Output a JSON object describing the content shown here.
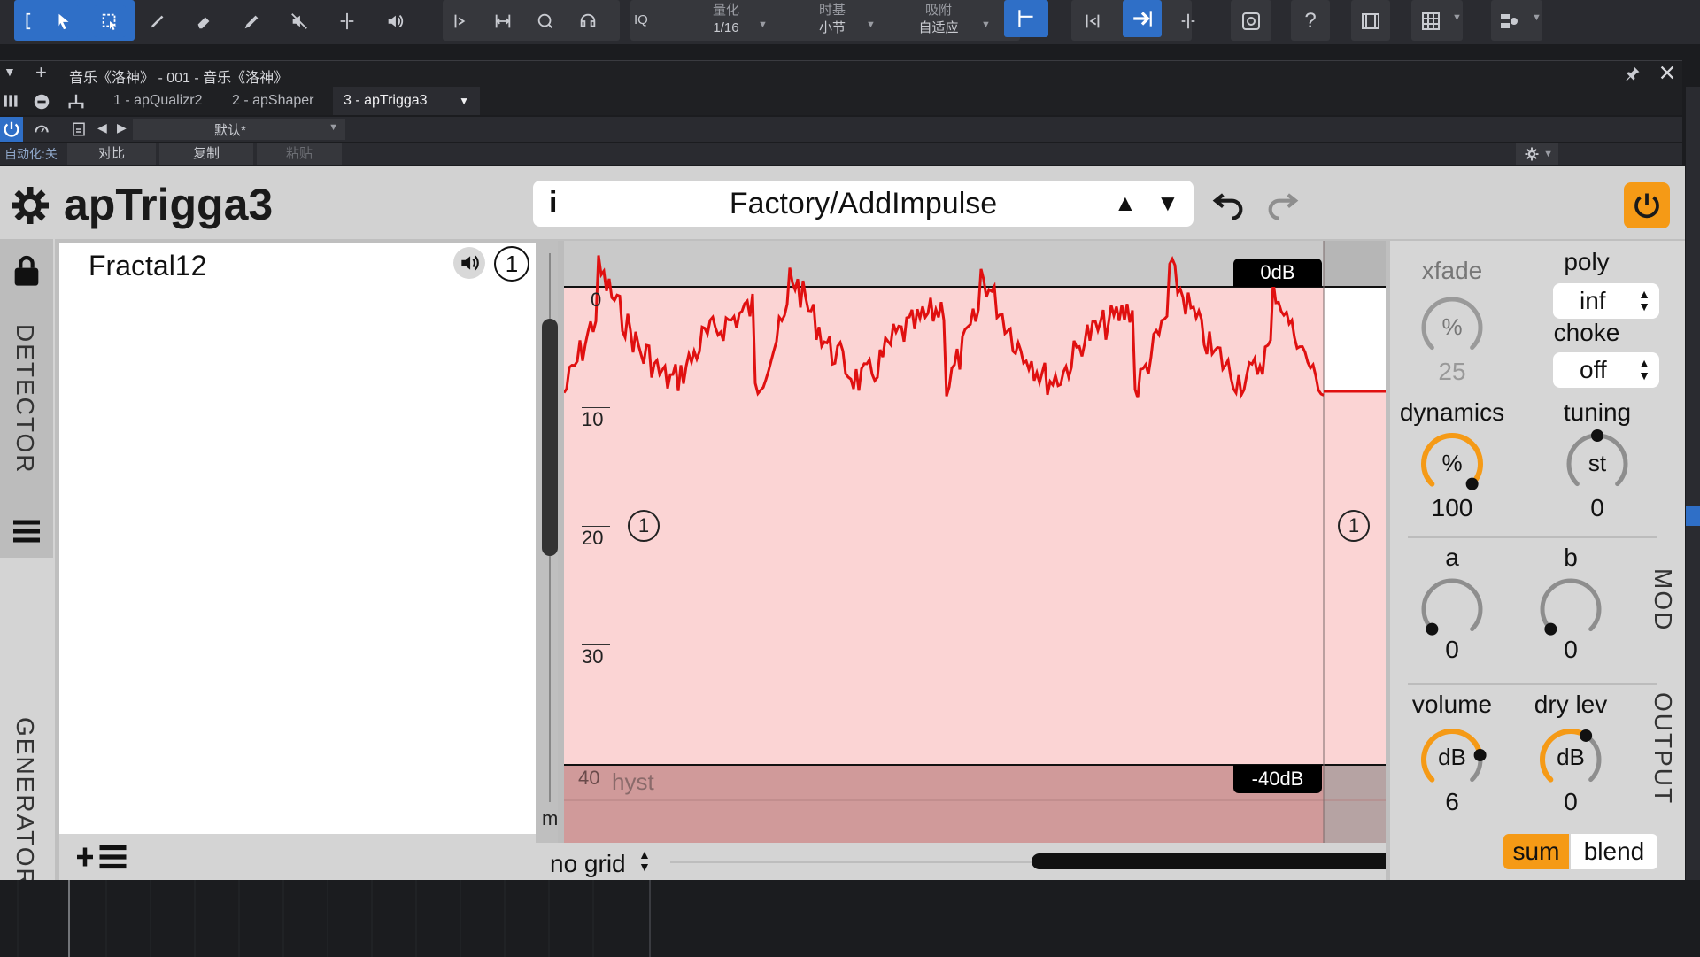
{
  "toolbar": {
    "quantize_label": "量化",
    "quantize_value": "1/16",
    "timebase_label": "时基",
    "timebase_value": "小节",
    "snap_label": "吸附",
    "snap_value": "自适应",
    "iq_label": "IQ",
    "help_label": "?"
  },
  "window": {
    "title": "音乐《洛神》 - 001 - 音乐《洛神》",
    "tabs": [
      {
        "label": "1 - apQualizr2"
      },
      {
        "label": "2 - apShaper"
      },
      {
        "label": "3 - apTrigga3"
      }
    ],
    "preset_name": "默认*",
    "automation_label": "自动化:关",
    "compare_label": "对比",
    "copy_label": "复制",
    "paste_label": "粘贴"
  },
  "plugin": {
    "name": "apTrigga3",
    "preset": "Factory/AddImpulse",
    "info_label": "i",
    "accent_color": "#f59a16",
    "side_tabs": {
      "detector": "DETECTOR",
      "generator": "GENERATOR"
    },
    "list_item": {
      "name": "Fractal12",
      "channel": "1"
    },
    "graph": {
      "top_badge": "0dB",
      "bottom_badge": "-40dB",
      "scale_labels": [
        "0",
        "10",
        "20",
        "30",
        "40"
      ],
      "hyst_label": "hyst",
      "m_label": "m",
      "left_marker": "1",
      "right_marker": "1",
      "signal_color": "#e01010"
    },
    "grid": {
      "label": "no grid"
    },
    "controls": {
      "xfade": {
        "label": "xfade",
        "unit": "%",
        "value": "25",
        "fraction": 0.25
      },
      "poly": {
        "label": "poly",
        "value": "inf"
      },
      "choke": {
        "label": "choke",
        "value": "off"
      },
      "dynamics": {
        "label": "dynamics",
        "unit": "%",
        "value": "100",
        "fraction": 1.0
      },
      "tuning": {
        "label": "tuning",
        "unit": "st",
        "value": "0",
        "fraction": 0.5
      },
      "mod_a": {
        "label": "a",
        "value": "0",
        "fraction": 0.0
      },
      "mod_b": {
        "label": "b",
        "value": "0",
        "fraction": 0.0
      },
      "volume": {
        "label": "volume",
        "unit": "dB",
        "value": "6",
        "fraction": 0.8
      },
      "dry_level": {
        "label": "dry lev",
        "unit": "dB",
        "value": "0",
        "fraction": 0.62
      },
      "mod_section": "MOD",
      "output_section": "OUTPUT",
      "sum_label": "sum",
      "blend_label": "blend"
    }
  }
}
